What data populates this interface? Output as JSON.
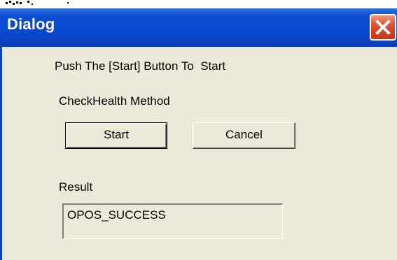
{
  "window": {
    "title": "Dialog",
    "colors": {
      "titlebar": "#0b4fd6",
      "close_button": "#d1401f",
      "client_background": "#ece9d8"
    }
  },
  "icons": {
    "close": "close-icon"
  },
  "instruction_text": "Push The [Start] Button To  Start",
  "method_label": "CheckHealth Method",
  "buttons": {
    "start_label": "Start",
    "cancel_label": "Cancel"
  },
  "result": {
    "label": "Result",
    "value": "OPOS_SUCCESS"
  }
}
